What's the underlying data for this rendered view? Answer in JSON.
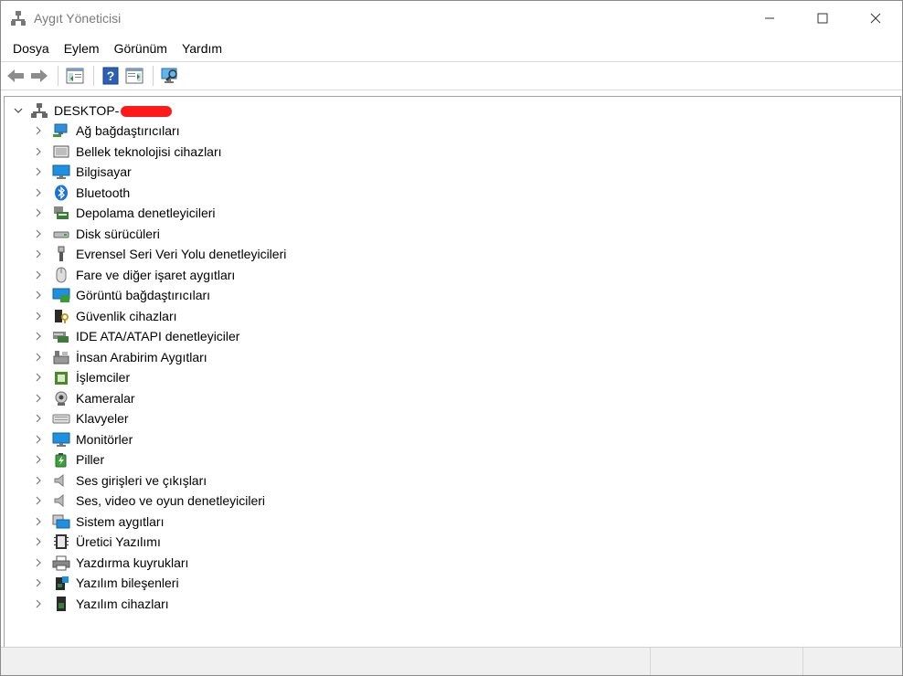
{
  "window": {
    "title": "Aygıt Yöneticisi",
    "controls": {
      "minimize": "—",
      "maximize": "☐",
      "close": "✕"
    }
  },
  "menu": [
    "Dosya",
    "Eylem",
    "Görünüm",
    "Yardım"
  ],
  "toolbar": {
    "buttons": [
      "back-arrow-icon",
      "forward-arrow-icon",
      "properties-icon",
      "help-icon",
      "action-pane-icon",
      "scan-monitor-icon"
    ]
  },
  "tree": {
    "root": {
      "label": "DESKTOP-",
      "expanded": true
    },
    "categories": [
      {
        "label": "Ağ bağdaştırıcıları",
        "icon": "network-adapter-icon",
        "color": "#2f8fd8"
      },
      {
        "label": "Bellek teknolojisi cihazları",
        "icon": "memory-device-icon",
        "color": "#555555"
      },
      {
        "label": "Bilgisayar",
        "icon": "computer-icon",
        "color": "#1e90e0"
      },
      {
        "label": "Bluetooth",
        "icon": "bluetooth-icon",
        "color": "#1a73d9"
      },
      {
        "label": "Depolama denetleyicileri",
        "icon": "storage-controller-icon",
        "color": "#3a7d3a"
      },
      {
        "label": "Disk sürücüleri",
        "icon": "disk-drive-icon",
        "color": "#666666"
      },
      {
        "label": "Evrensel Seri Veri Yolu denetleyicileri",
        "icon": "usb-icon",
        "color": "#555555"
      },
      {
        "label": "Fare ve diğer işaret aygıtları",
        "icon": "mouse-icon",
        "color": "#777777"
      },
      {
        "label": "Görüntü bağdaştırıcıları",
        "icon": "display-adapter-icon",
        "color": "#1e90e0"
      },
      {
        "label": "Güvenlik cihazları",
        "icon": "security-device-icon",
        "color": "#c79a1a"
      },
      {
        "label": "IDE ATA/ATAPI denetleyiciler",
        "icon": "ide-controller-icon",
        "color": "#3a7d3a"
      },
      {
        "label": "İnsan Arabirim Aygıtları",
        "icon": "hid-icon",
        "color": "#555555"
      },
      {
        "label": "İşlemciler",
        "icon": "processor-icon",
        "color": "#4a8a2a"
      },
      {
        "label": "Kameralar",
        "icon": "camera-icon",
        "color": "#666666"
      },
      {
        "label": "Klavyeler",
        "icon": "keyboard-icon",
        "color": "#777777"
      },
      {
        "label": "Monitörler",
        "icon": "monitor-icon",
        "color": "#1e90e0"
      },
      {
        "label": "Piller",
        "icon": "battery-icon",
        "color": "#3aa03a"
      },
      {
        "label": "Ses girişleri ve çıkışları",
        "icon": "speaker-icon",
        "color": "#777777"
      },
      {
        "label": "Ses, video ve oyun denetleyicileri",
        "icon": "sound-controller-icon",
        "color": "#777777"
      },
      {
        "label": "Sistem aygıtları",
        "icon": "system-device-icon",
        "color": "#1e90e0"
      },
      {
        "label": "Üretici Yazılımı",
        "icon": "firmware-icon",
        "color": "#333333"
      },
      {
        "label": "Yazdırma kuyrukları",
        "icon": "printer-icon",
        "color": "#555555"
      },
      {
        "label": "Yazılım bileşenleri",
        "icon": "software-component-icon",
        "color": "#3a7d3a"
      },
      {
        "label": "Yazılım cihazları",
        "icon": "software-device-icon",
        "color": "#3a7d3a"
      }
    ]
  },
  "colors": {
    "redaction": "#ff1a1a",
    "title_text": "#7a7a7a",
    "accent": "#1e90e0"
  }
}
